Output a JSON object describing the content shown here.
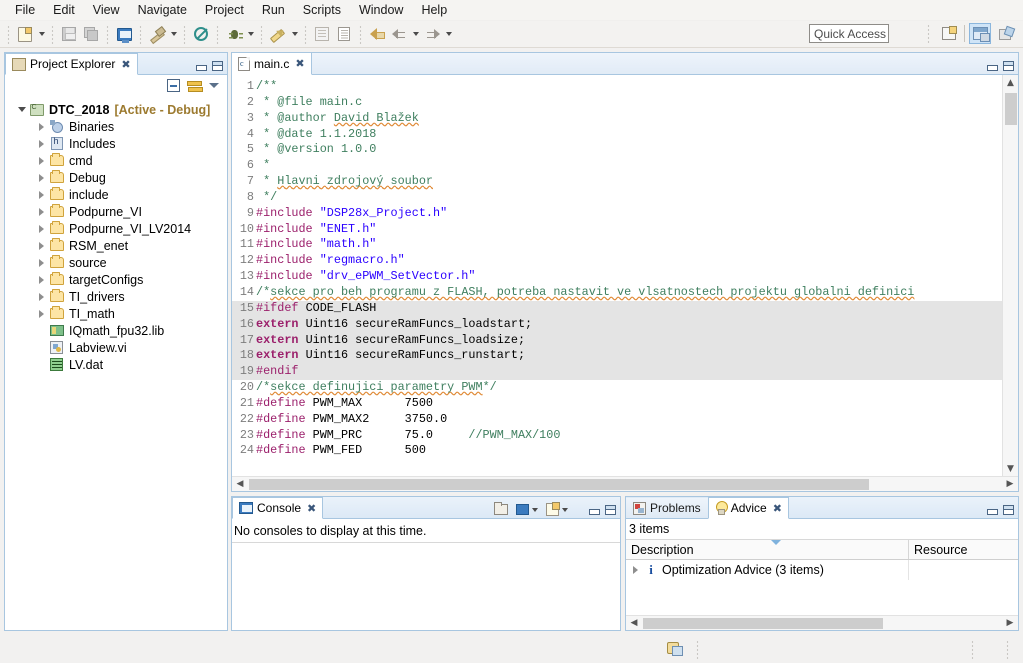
{
  "menubar": {
    "items": [
      "File",
      "Edit",
      "View",
      "Navigate",
      "Project",
      "Run",
      "Scripts",
      "Window",
      "Help"
    ]
  },
  "toolbar": {
    "quick_access_placeholder": "Quick Access",
    "buttons": [
      {
        "name": "new-button",
        "icon": "new-file-icon"
      },
      {
        "name": "save-button",
        "icon": "save-icon"
      },
      {
        "name": "save-all-button",
        "icon": "save-all-icon"
      },
      {
        "name": "new-target-config-button",
        "icon": "monitor-icon"
      },
      {
        "name": "build-button",
        "icon": "hammer-icon"
      },
      {
        "name": "skip-breakpoints-button",
        "icon": "no-entry-icon"
      },
      {
        "name": "debug-button",
        "icon": "bug-icon"
      },
      {
        "name": "run-button",
        "icon": "pen-icon"
      },
      {
        "name": "new-file-doc-button",
        "icon": "document-icon"
      },
      {
        "name": "properties-button",
        "icon": "document-lines-icon"
      },
      {
        "name": "last-edit-button",
        "icon": "back-edit-arrow-icon"
      },
      {
        "name": "back-button",
        "icon": "back-arrow-icon"
      },
      {
        "name": "forward-button",
        "icon": "forward-arrow-icon"
      }
    ],
    "perspective_buttons": [
      {
        "name": "open-perspective-button",
        "icon": "new-perspective-icon"
      },
      {
        "name": "perspective-ccs-edit",
        "icon": "ccs-edit-icon"
      },
      {
        "name": "perspective-ccs-debug",
        "icon": "ccs-debug-icon"
      }
    ]
  },
  "project_explorer": {
    "tab_label": "Project Explorer",
    "toolbar": [
      "collapse-all-icon",
      "link-with-editor-icon",
      "view-menu-icon"
    ],
    "tree": [
      {
        "label": "DTC_2018",
        "suffix": "[Active - Debug]",
        "icon": "project-icon",
        "indent": 0,
        "twisty": "open",
        "bold": true
      },
      {
        "label": "Binaries",
        "icon": "binaries-icon",
        "indent": 1,
        "twisty": "closed"
      },
      {
        "label": "Includes",
        "icon": "includes-icon",
        "indent": 1,
        "twisty": "closed"
      },
      {
        "label": "cmd",
        "icon": "folder-icon",
        "indent": 1,
        "twisty": "closed"
      },
      {
        "label": "Debug",
        "icon": "folder-icon",
        "indent": 1,
        "twisty": "closed"
      },
      {
        "label": "include",
        "icon": "folder-icon",
        "indent": 1,
        "twisty": "closed"
      },
      {
        "label": "Podpurne_VI",
        "icon": "folder-icon",
        "indent": 1,
        "twisty": "closed"
      },
      {
        "label": "Podpurne_VI_LV2014",
        "icon": "folder-icon",
        "indent": 1,
        "twisty": "closed"
      },
      {
        "label": "RSM_enet",
        "icon": "folder-icon",
        "indent": 1,
        "twisty": "closed"
      },
      {
        "label": "source",
        "icon": "folder-icon",
        "indent": 1,
        "twisty": "closed"
      },
      {
        "label": "targetConfigs",
        "icon": "folder-icon",
        "indent": 1,
        "twisty": "closed"
      },
      {
        "label": "TI_drivers",
        "icon": "folder-icon",
        "indent": 1,
        "twisty": "closed"
      },
      {
        "label": "TI_math",
        "icon": "folder-icon",
        "indent": 1,
        "twisty": "closed"
      },
      {
        "label": "IQmath_fpu32.lib",
        "icon": "library-icon",
        "indent": 1,
        "twisty": "none"
      },
      {
        "label": "Labview.vi",
        "icon": "vi-file-icon",
        "indent": 1,
        "twisty": "none"
      },
      {
        "label": "LV.dat",
        "icon": "dat-file-icon",
        "indent": 1,
        "twisty": "none"
      }
    ]
  },
  "editor": {
    "tab_label": "main.c",
    "lines": [
      {
        "n": 1,
        "shaded": false,
        "tokens": [
          {
            "t": "/**",
            "c": "comment"
          }
        ]
      },
      {
        "n": 2,
        "shaded": false,
        "tokens": [
          {
            "t": " * @file main.c",
            "c": "comment"
          }
        ]
      },
      {
        "n": 3,
        "shaded": false,
        "tokens": [
          {
            "t": " * @author ",
            "c": "comment"
          },
          {
            "t": "David Blažek",
            "c": "comment-sp"
          }
        ]
      },
      {
        "n": 4,
        "shaded": false,
        "tokens": [
          {
            "t": " * @date 1.1.2018",
            "c": "comment"
          }
        ]
      },
      {
        "n": 5,
        "shaded": false,
        "tokens": [
          {
            "t": " * @version 1.0.0",
            "c": "comment"
          }
        ]
      },
      {
        "n": 6,
        "shaded": false,
        "tokens": [
          {
            "t": " *",
            "c": "comment"
          }
        ]
      },
      {
        "n": 7,
        "shaded": false,
        "tokens": [
          {
            "t": " * ",
            "c": "comment"
          },
          {
            "t": "Hlavni zdrojový soubor",
            "c": "comment-sp"
          }
        ]
      },
      {
        "n": 8,
        "shaded": false,
        "tokens": [
          {
            "t": " */",
            "c": "comment"
          }
        ]
      },
      {
        "n": 9,
        "shaded": false,
        "tokens": [
          {
            "t": "#include ",
            "c": "pre"
          },
          {
            "t": "\"DSP28x_Project.h\"",
            "c": "str"
          }
        ]
      },
      {
        "n": 10,
        "shaded": false,
        "tokens": [
          {
            "t": "#include ",
            "c": "pre"
          },
          {
            "t": "\"ENET.h\"",
            "c": "str"
          }
        ]
      },
      {
        "n": 11,
        "shaded": false,
        "tokens": [
          {
            "t": "#include ",
            "c": "pre"
          },
          {
            "t": "\"math.h\"",
            "c": "str"
          }
        ]
      },
      {
        "n": 12,
        "shaded": false,
        "tokens": [
          {
            "t": "#include ",
            "c": "pre"
          },
          {
            "t": "\"regmacro.h\"",
            "c": "str"
          }
        ]
      },
      {
        "n": 13,
        "shaded": false,
        "tokens": [
          {
            "t": "#include ",
            "c": "pre"
          },
          {
            "t": "\"drv_ePWM_SetVector.h\"",
            "c": "str"
          }
        ]
      },
      {
        "n": 14,
        "shaded": false,
        "tokens": [
          {
            "t": "/*",
            "c": "comment"
          },
          {
            "t": "sekce pro beh programu z FLASH, potreba nastavit ve vlsatnostech projektu globalni definici",
            "c": "comment-sp"
          }
        ]
      },
      {
        "n": 15,
        "shaded": true,
        "tokens": [
          {
            "t": "#ifdef",
            "c": "pre"
          },
          {
            "t": " CODE_FLASH",
            "c": "plain"
          }
        ]
      },
      {
        "n": 16,
        "shaded": true,
        "tokens": [
          {
            "t": "extern",
            "c": "kw"
          },
          {
            "t": " Uint16 secureRamFuncs_loadstart;",
            "c": "plain"
          }
        ]
      },
      {
        "n": 17,
        "shaded": true,
        "tokens": [
          {
            "t": "extern",
            "c": "kw"
          },
          {
            "t": " Uint16 secureRamFuncs_loadsize;",
            "c": "plain"
          }
        ]
      },
      {
        "n": 18,
        "shaded": true,
        "tokens": [
          {
            "t": "extern",
            "c": "kw"
          },
          {
            "t": " Uint16 secureRamFuncs_runstart;",
            "c": "plain"
          }
        ]
      },
      {
        "n": 19,
        "shaded": true,
        "tokens": [
          {
            "t": "#endif",
            "c": "pre"
          }
        ]
      },
      {
        "n": 20,
        "shaded": false,
        "tokens": [
          {
            "t": "/*",
            "c": "comment"
          },
          {
            "t": "sekce definujici parametry PWM",
            "c": "comment-sp"
          },
          {
            "t": "*/",
            "c": "comment"
          }
        ]
      },
      {
        "n": 21,
        "shaded": false,
        "tokens": [
          {
            "t": "#define",
            "c": "pre"
          },
          {
            "t": " PWM_MAX      7500",
            "c": "plain"
          }
        ]
      },
      {
        "n": 22,
        "shaded": false,
        "tokens": [
          {
            "t": "#define",
            "c": "pre"
          },
          {
            "t": " PWM_MAX2     3750.0",
            "c": "plain"
          }
        ]
      },
      {
        "n": 23,
        "shaded": false,
        "tokens": [
          {
            "t": "#define",
            "c": "pre"
          },
          {
            "t": " PWM_PRC      75.0     ",
            "c": "plain"
          },
          {
            "t": "//PWM_MAX/100",
            "c": "comment"
          }
        ]
      },
      {
        "n": 24,
        "shaded": false,
        "tokens": [
          {
            "t": "#define",
            "c": "pre"
          },
          {
            "t": " PWM_FED      500",
            "c": "plain"
          }
        ]
      }
    ]
  },
  "console": {
    "tab_label": "Console",
    "message": "No consoles to display at this time.",
    "toolbar": [
      "open-console-icon",
      "pin-console-icon",
      "display-selected-console-icon",
      "new-console-view-icon"
    ]
  },
  "advice": {
    "tabs": [
      {
        "label": "Problems",
        "icon": "problems-icon",
        "active": false
      },
      {
        "label": "Advice",
        "icon": "bulb-icon",
        "active": true
      }
    ],
    "item_count_label": "3 items",
    "columns": [
      "Description",
      "Resource"
    ],
    "rows": [
      {
        "description": "Optimization Advice (3 items)",
        "resource": "",
        "icon": "info-icon",
        "twisty": "closed"
      }
    ]
  },
  "statusbar": {
    "icon": "build-status-icon"
  },
  "colors": {
    "accent_border": "#a8c6e0",
    "comment": "#3f7f5f",
    "preprocessor": "#9b1f6b",
    "string": "#2a00ff",
    "shaded_block": "#e4e4e4",
    "active_project": "#9c7a2f"
  }
}
